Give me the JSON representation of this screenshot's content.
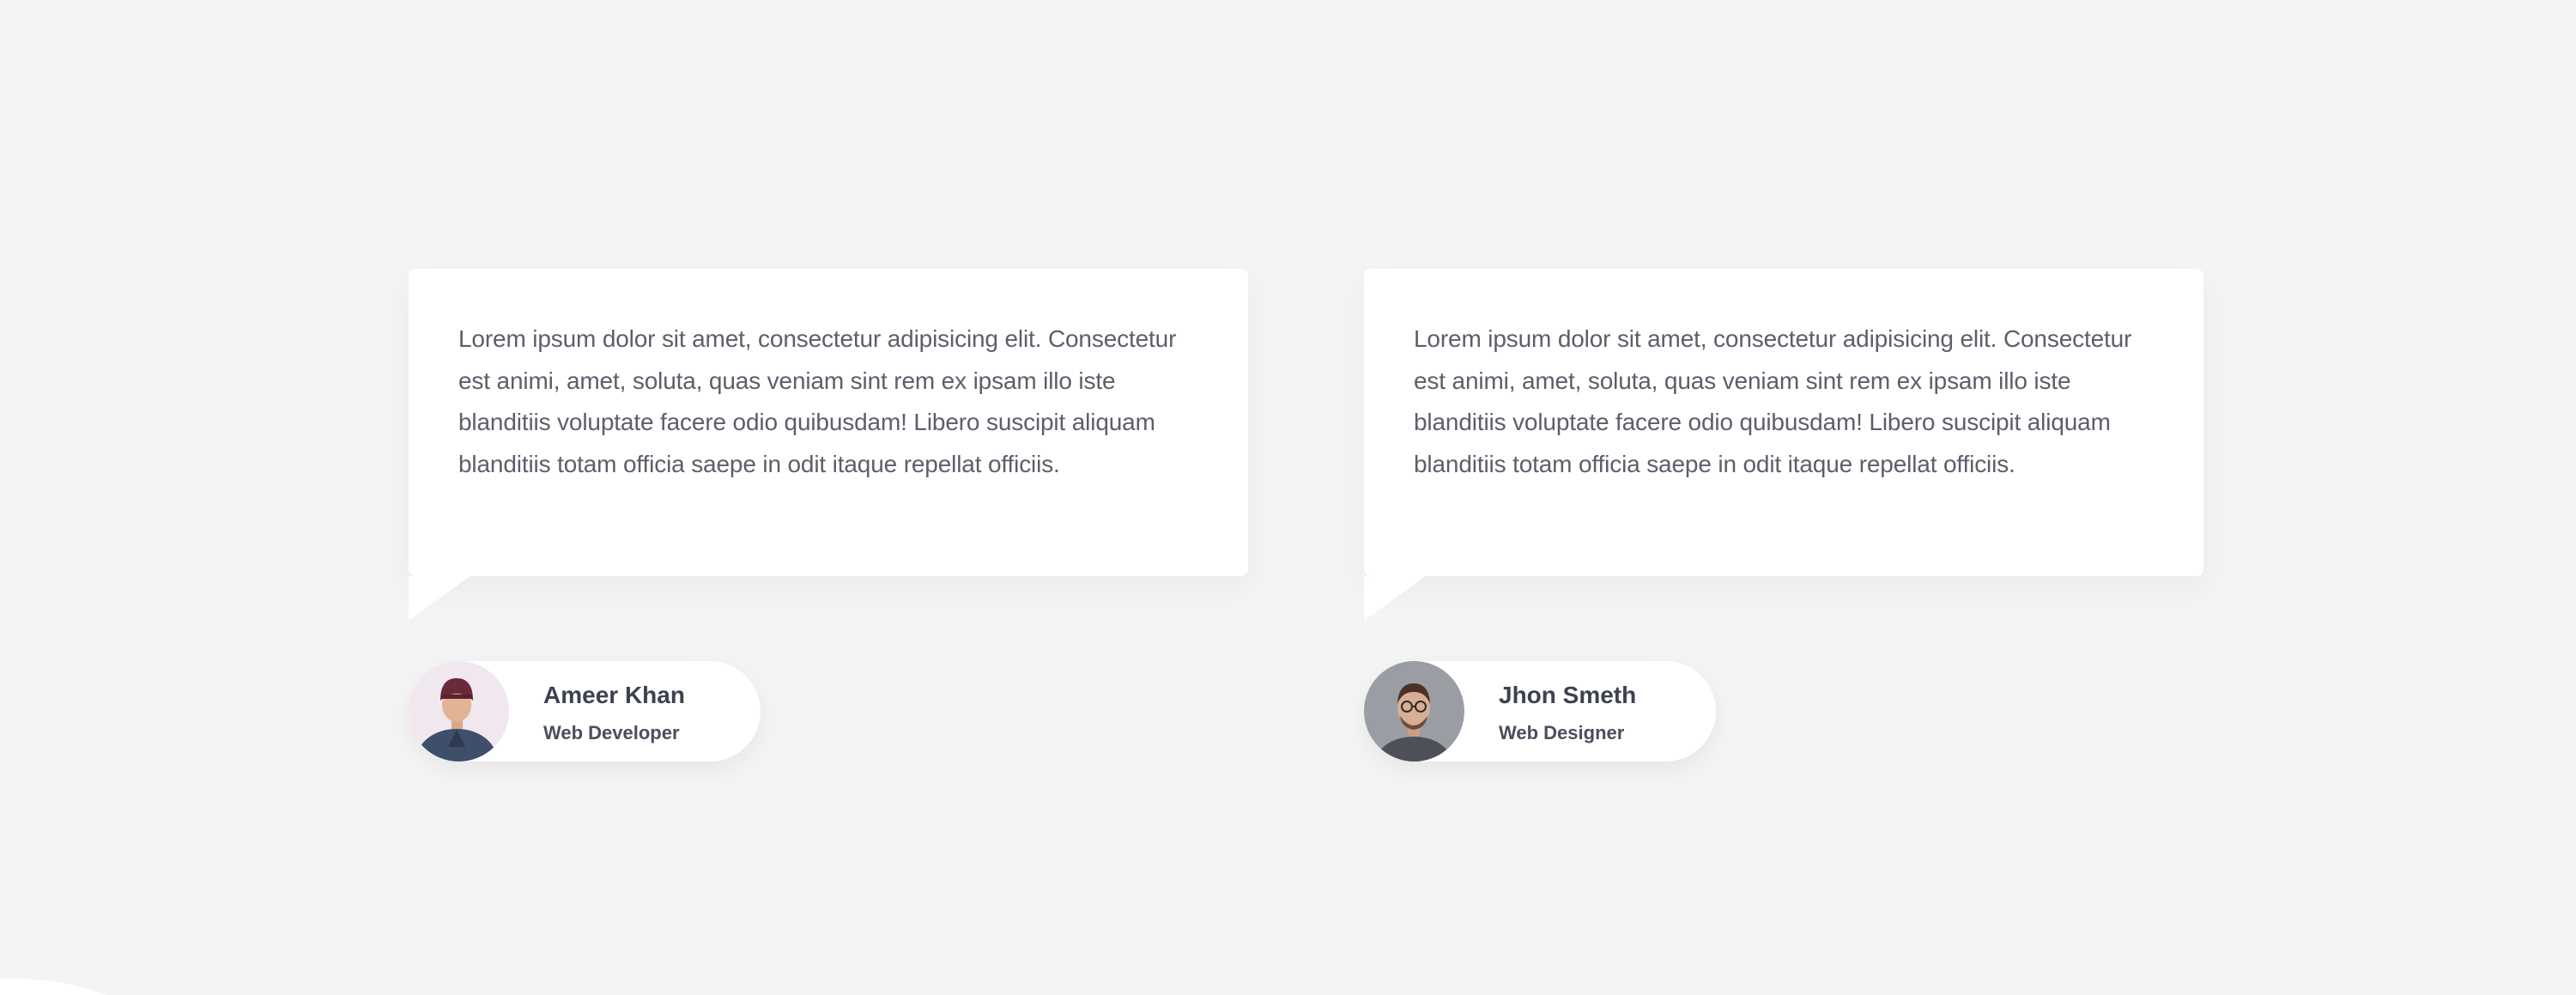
{
  "testimonials": [
    {
      "quote": "Lorem ipsum dolor sit amet, consectetur adipisicing elit. Consectetur est animi, amet, soluta, quas veniam sint rem ex ipsam illo iste blanditiis voluptate facere odio quibusdam! Libero suscipit aliquam blanditiis totam officia saepe in odit itaque repellat officiis.",
      "author_name": "Ameer Khan",
      "author_role": "Web Developer",
      "avatar_icon": "person-avatar-icon"
    },
    {
      "quote": "Lorem ipsum dolor sit amet, consectetur adipisicing elit. Consectetur est animi, amet, soluta, quas veniam sint rem ex ipsam illo iste blanditiis voluptate facere odio quibusdam! Libero suscipit aliquam blanditiis totam officia saepe in odit itaque repellat officiis.",
      "author_name": "Jhon Smeth",
      "author_role": "Web Designer",
      "avatar_icon": "person-avatar-icon"
    }
  ],
  "colors": {
    "background": "#f4f4f4",
    "card": "#ffffff",
    "quote_text": "#5c5f6a",
    "author_name": "#3d4150",
    "author_role": "#4a4e5c"
  }
}
